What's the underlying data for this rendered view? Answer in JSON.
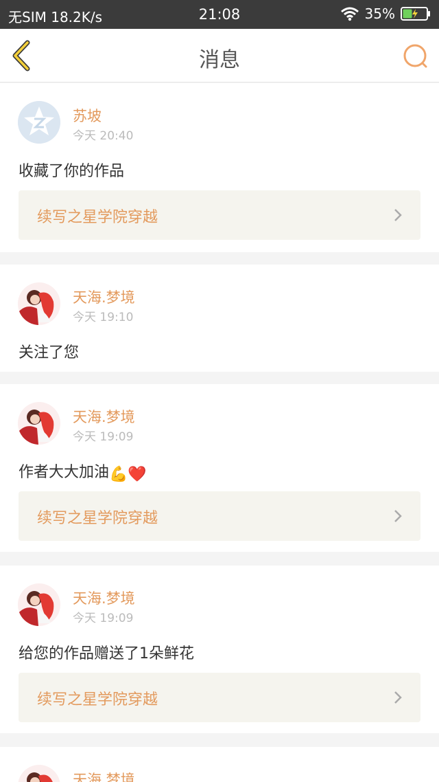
{
  "status_bar": {
    "carrier": "无SIM",
    "speed": "18.2K/s",
    "time": "21:08",
    "battery": "35%"
  },
  "nav": {
    "title": "消息",
    "back_icon": "chevron-left-icon",
    "search_icon": "search-icon",
    "accent_color": "#e8a53d"
  },
  "messages": [
    {
      "name": "苏坡",
      "time": "今天 20:40",
      "text": "收藏了你的作品",
      "work": "续写之星学院穿越",
      "avatar": "default-avatar-icon"
    },
    {
      "name": "天海.梦境",
      "time": "今天 19:10",
      "text": "关注了您",
      "avatar": "anime-avatar"
    },
    {
      "name": "天海.梦境",
      "time": "今天 19:09",
      "text": "作者大大加油",
      "emoji": "💪❤️",
      "work": "续写之星学院穿越",
      "avatar": "anime-avatar"
    },
    {
      "name": "天海.梦境",
      "time": "今天 19:09",
      "text": "给您的作品赠送了1朵鲜花",
      "work": "续写之星学院穿越",
      "avatar": "anime-avatar"
    },
    {
      "name": "天海.梦境",
      "avatar": "anime-avatar"
    }
  ]
}
